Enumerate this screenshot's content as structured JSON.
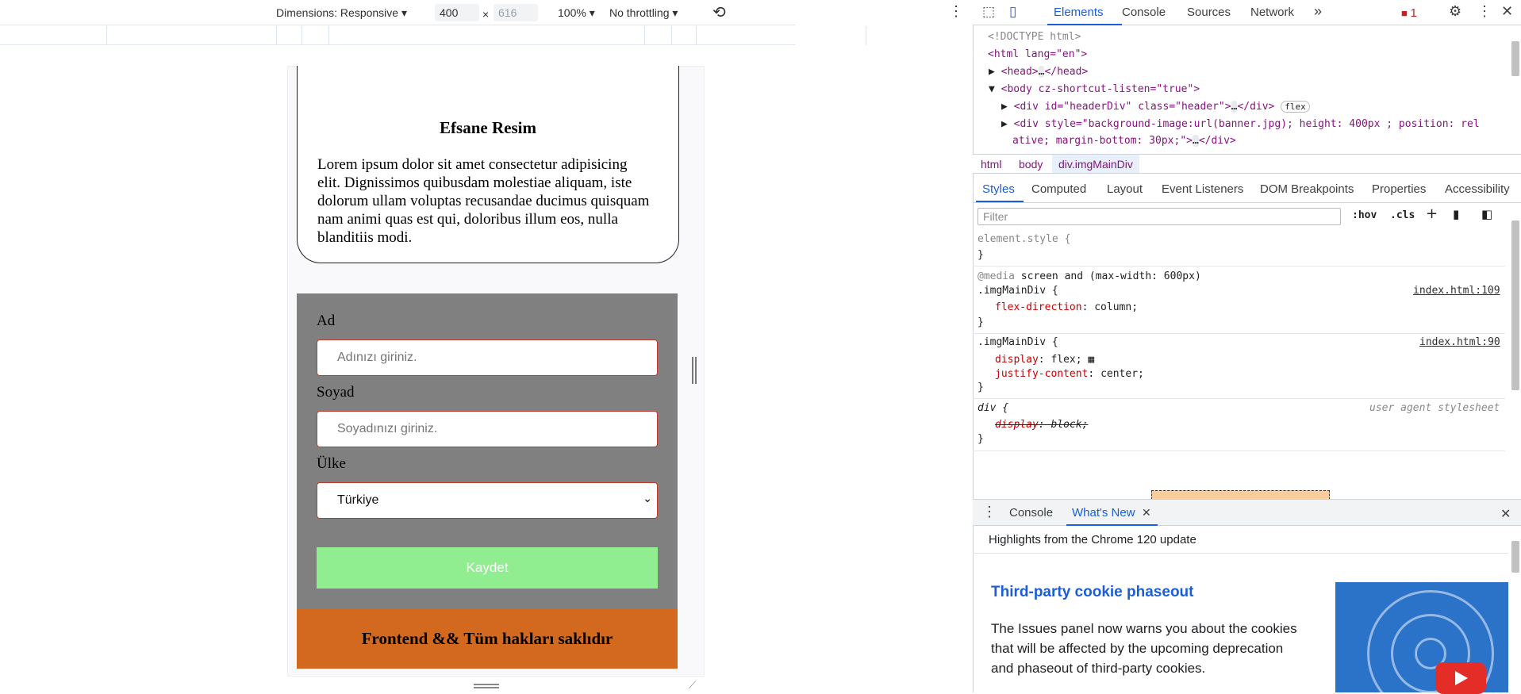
{
  "device_toolbar": {
    "dimensions_label": "Dimensions: Responsive",
    "width_value": "400",
    "times": "×",
    "height_value": "616",
    "zoom": "100%",
    "throttling": "No throttling",
    "rotate_icon": "rotate-icon",
    "more_icon": "kebab-icon"
  },
  "page": {
    "card_title": "Efsane Resim",
    "card_text": "Lorem ipsum dolor sit amet consectetur adipisicing elit. Dignissimos quibusdam molestiae aliquam, iste dolorum ullam voluptas recusandae ducimus quisquam nam animi quas est qui, doloribus illum eos, nulla blanditiis modi.",
    "form": {
      "first_name_label": "Ad",
      "first_name_placeholder": "Adınızı giriniz.",
      "last_name_label": "Soyad",
      "last_name_placeholder": "Soyadınızı giriniz.",
      "country_label": "Ülke",
      "country_selected": "Türkiye",
      "submit_label": "Kaydet"
    },
    "footer_text": "Frontend && Tüm hakları saklıdır"
  },
  "devtools": {
    "tabs": [
      "Elements",
      "Console",
      "Sources",
      "Network"
    ],
    "active_tab": "Elements",
    "more_tabs": "»",
    "issues_count": "1",
    "dom_lines": {
      "doctype": "<!DOCTYPE html>",
      "html_open": "<html lang=\"en\">",
      "head": "<head>",
      "head_close": "</head>",
      "body_open": "<body cz-shortcut-listen=\"true\">",
      "header_div": "<div id=\"headerDiv\" class=\"header\">",
      "header_div_close": "</div>",
      "flex_badge": "flex",
      "style_div_1": "<div style=\"background-image:url(banner.jpg); height: 400px ; position: rel",
      "style_div_2": "ative; margin-bottom: 30px;\">",
      "style_div_close": "</div>",
      "ellipsis": "…"
    },
    "breadcrumbs": [
      "html",
      "body",
      "div.imgMainDiv"
    ],
    "style_tabs": [
      "Styles",
      "Computed",
      "Layout",
      "Event Listeners",
      "DOM Breakpoints",
      "Properties",
      "Accessibility"
    ],
    "filter_placeholder": "Filter",
    "filter_buttons": {
      "hov": ":hov",
      "cls": ".cls"
    },
    "styles": {
      "element_style": "element.style {",
      "close_brace": "}",
      "media_keyword": "@media",
      "media_query": "screen and (max-width: 600px)",
      "rule1_selector": ".imgMainDiv {",
      "rule1_link": "index.html:109",
      "rule1_prop": "flex-direction",
      "rule1_val": "column;",
      "rule2_selector": ".imgMainDiv {",
      "rule2_link": "index.html:90",
      "rule2_prop1": "display",
      "rule2_val1": "flex;",
      "rule2_prop2": "justify-content",
      "rule2_val2": "center;",
      "rule3_selector": "div {",
      "rule3_source": "user agent stylesheet",
      "rule3_prop": "display",
      "rule3_val": ": block;"
    },
    "drawer": {
      "tabs": [
        "Console",
        "What's New"
      ],
      "active_tab": "What's New",
      "highlights": "Highlights from the Chrome 120 update",
      "article_title": "Third-party cookie phaseout",
      "article_text": "The Issues panel now warns you about the cookies that will be affected by the upcoming deprecation and phaseout of third-party cookies."
    }
  }
}
